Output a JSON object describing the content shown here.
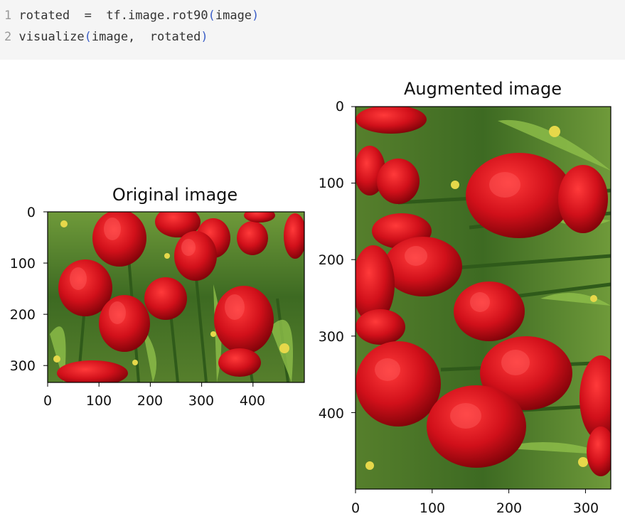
{
  "code": {
    "lines": [
      {
        "number": "1",
        "tokens": [
          "rotated  =  tf.image.rot90",
          "(",
          "image",
          ")"
        ]
      },
      {
        "number": "2",
        "tokens": [
          "visualize",
          "(",
          "image,  rotated",
          ")"
        ]
      }
    ]
  },
  "figures": [
    {
      "id": "original",
      "title": "Original image",
      "image_size": [
        500,
        333
      ],
      "xticks": [
        "0",
        "100",
        "200",
        "300",
        "400"
      ],
      "yticks": [
        "0",
        "100",
        "200",
        "300"
      ]
    },
    {
      "id": "augmented",
      "title": "Augmented image",
      "image_size": [
        333,
        500
      ],
      "xticks": [
        "0",
        "100",
        "200",
        "300"
      ],
      "yticks": [
        "0",
        "100",
        "200",
        "300",
        "400"
      ]
    }
  ],
  "colors": {
    "tulip_red": "#d1101a",
    "foliage_green": "#4a7a2a",
    "bud_yellow": "#e6d84a",
    "code_paren": "#3d60c8"
  }
}
